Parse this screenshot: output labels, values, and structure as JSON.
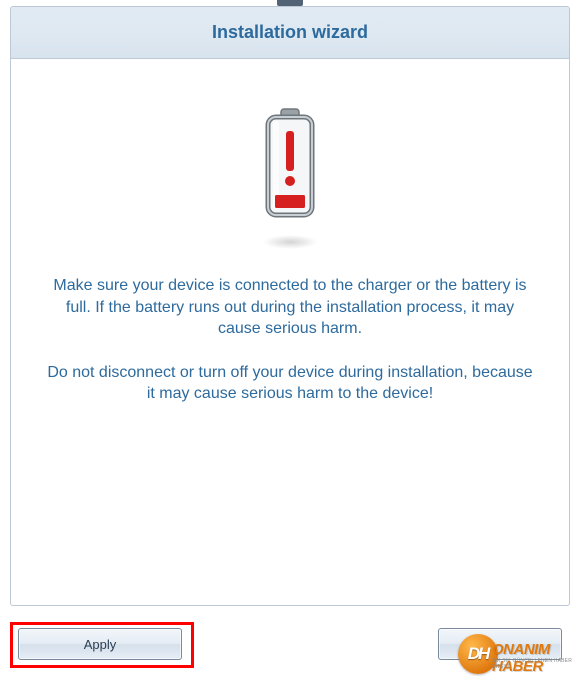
{
  "header": {
    "title": "Installation wizard"
  },
  "body": {
    "warning1": "Make sure your device is connected to the charger or the battery is full. If the battery runs out during the installation process, it may cause serious harm.",
    "warning2": "Do not disconnect or turn off your device during installation, because it may cause serious harm to the device!"
  },
  "buttons": {
    "apply_label": "Apply",
    "right_label": ""
  },
  "watermark": {
    "badge": "DH",
    "brand": "ONANIM HABER",
    "tagline": "SIK SIK GÜNCELLENEN HABER SİTESİ"
  },
  "icon": {
    "name": "battery-warning-icon"
  }
}
